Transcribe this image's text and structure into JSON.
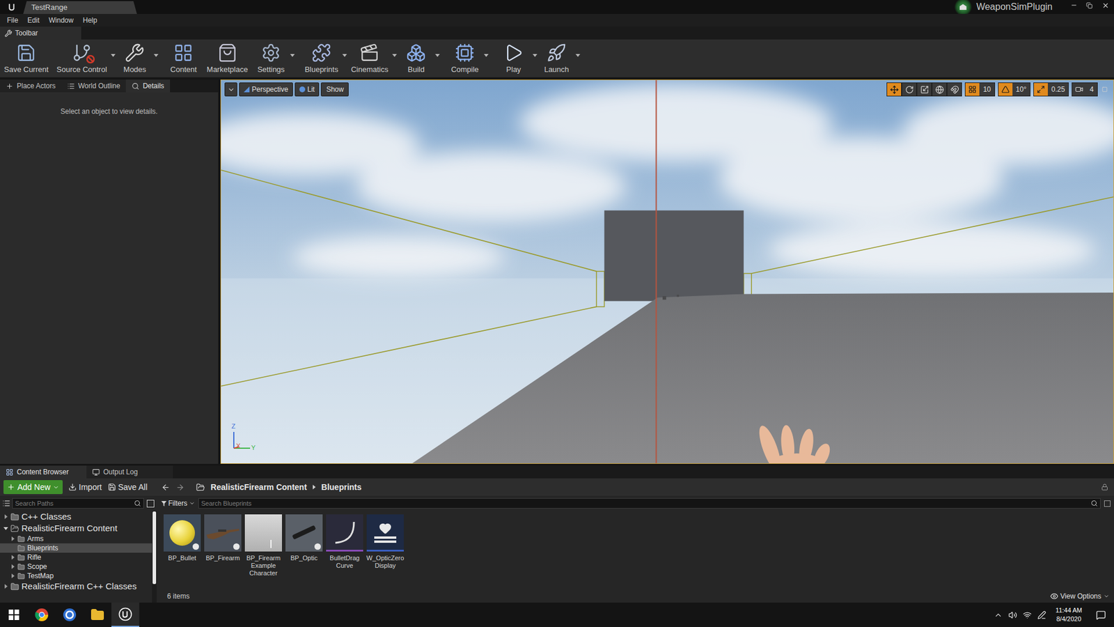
{
  "window": {
    "tab_title": "TestRange",
    "project": "WeaponSimPlugin"
  },
  "menu": [
    "File",
    "Edit",
    "Window",
    "Help"
  ],
  "toolbar": {
    "tab": "Toolbar",
    "buttons": [
      {
        "label": "Save Current",
        "kind": "save",
        "dropdown": false
      },
      {
        "label": "Source Control",
        "kind": "source-control",
        "dropdown": true
      },
      {
        "label": "Modes",
        "kind": "modes",
        "dropdown": true
      },
      {
        "label": "Content",
        "kind": "content",
        "dropdown": false
      },
      {
        "label": "Marketplace",
        "kind": "marketplace",
        "dropdown": false
      },
      {
        "label": "Settings",
        "kind": "settings",
        "dropdown": true
      },
      {
        "label": "Blueprints",
        "kind": "blueprints",
        "dropdown": true
      },
      {
        "label": "Cinematics",
        "kind": "cinematics",
        "dropdown": true
      },
      {
        "label": "Build",
        "kind": "build",
        "dropdown": true
      },
      {
        "label": "Compile",
        "kind": "compile",
        "dropdown": true
      },
      {
        "label": "Play",
        "kind": "play",
        "dropdown": true
      },
      {
        "label": "Launch",
        "kind": "launch",
        "dropdown": true
      }
    ]
  },
  "left_panel": {
    "tabs": [
      {
        "label": "Place Actors",
        "kind": "place",
        "selected": false
      },
      {
        "label": "World Outline",
        "kind": "outline",
        "selected": false
      },
      {
        "label": "Details",
        "kind": "details",
        "selected": true
      }
    ],
    "message": "Select an object to view details."
  },
  "viewport": {
    "view_mode": "Perspective",
    "lighting": "Lit",
    "show": "Show",
    "tools": [
      {
        "kind": "translate",
        "selected": true
      },
      {
        "kind": "rotate",
        "selected": false
      },
      {
        "kind": "scale",
        "selected": false
      },
      {
        "kind": "world",
        "selected": false
      },
      {
        "kind": "surface-snap",
        "selected": false
      }
    ],
    "snaps": [
      {
        "kind": "grid",
        "value": "10",
        "active": true
      },
      {
        "kind": "rotation",
        "value": "10°",
        "active": true
      },
      {
        "kind": "scale",
        "value": "0.25",
        "active": true
      },
      {
        "kind": "camera",
        "value": "4",
        "active": false
      }
    ],
    "axes": [
      "Z",
      "X",
      "Y"
    ]
  },
  "bottom_tabs": [
    {
      "label": "Content Browser",
      "selected": true
    },
    {
      "label": "Output Log",
      "selected": false
    }
  ],
  "content_browser": {
    "add_new": "Add New",
    "import": "Import",
    "save_all": "Save All",
    "breadcrumb": [
      "RealisticFirearm Content",
      "Blueprints"
    ],
    "search_paths_placeholder": "Search Paths",
    "filters": "Filters",
    "search_placeholder": "Search Blueprints",
    "tree": [
      {
        "label": "C++ Classes",
        "kind": "root",
        "expandable": true,
        "expanded": false,
        "selected": false
      },
      {
        "label": "RealisticFirearm Content",
        "kind": "root",
        "expandable": true,
        "expanded": true,
        "selected": false
      },
      {
        "label": "Arms",
        "kind": "folder",
        "expandable": true,
        "expanded": false,
        "selected": false
      },
      {
        "label": "Blueprints",
        "kind": "folder",
        "expandable": false,
        "expanded": false,
        "selected": true
      },
      {
        "label": "Rifle",
        "kind": "folder",
        "expandable": true,
        "expanded": false,
        "selected": false
      },
      {
        "label": "Scope",
        "kind": "folder",
        "expandable": true,
        "expanded": false,
        "selected": false
      },
      {
        "label": "TestMap",
        "kind": "folder",
        "expandable": true,
        "expanded": false,
        "selected": false
      },
      {
        "label": "RealisticFirearm C++ Classes",
        "kind": "root",
        "expandable": true,
        "expanded": false,
        "selected": false
      }
    ],
    "assets": [
      {
        "lines": [
          "BP_Bullet"
        ],
        "kind": "bullet"
      },
      {
        "lines": [
          "BP_Firearm"
        ],
        "kind": "firearm"
      },
      {
        "lines": [
          "BP_Firearm",
          "Example",
          "Character"
        ],
        "kind": "character"
      },
      {
        "lines": [
          "BP_Optic"
        ],
        "kind": "optic"
      },
      {
        "lines": [
          "BulletDrag",
          "Curve"
        ],
        "kind": "curve"
      },
      {
        "lines": [
          "W_OpticZero",
          "Display"
        ],
        "kind": "widget"
      }
    ],
    "item_count": "6 items",
    "view_options": "View Options"
  },
  "taskbar": {
    "time": "11:44 AM",
    "date": "8/4/2020"
  }
}
